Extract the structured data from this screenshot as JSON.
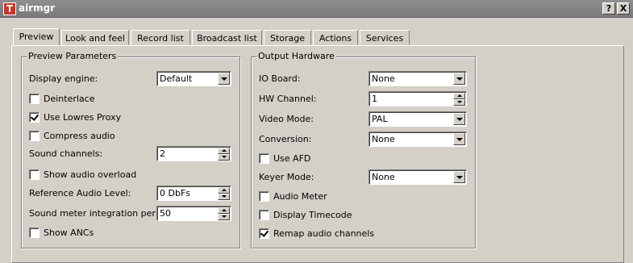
{
  "window": {
    "title": "airmgr",
    "help_label": "?",
    "close_label": "X"
  },
  "tabs": [
    {
      "label": "Preview",
      "active": true
    },
    {
      "label": "Look and feel"
    },
    {
      "label": "Record list"
    },
    {
      "label": "Broadcast list"
    },
    {
      "label": "Storage"
    },
    {
      "label": "Actions"
    },
    {
      "label": "Services"
    }
  ],
  "preview_parameters": {
    "title": "Preview Parameters",
    "display_engine": {
      "label": "Display engine:",
      "value": "Default"
    },
    "deinterlace": {
      "label": "Deinterlace",
      "checked": false
    },
    "use_lowres_proxy": {
      "label": "Use Lowres Proxy",
      "checked": true
    },
    "compress_audio": {
      "label": "Compress audio",
      "checked": false
    },
    "sound_channels": {
      "label": "Sound channels:",
      "value": "2"
    },
    "show_audio_overload": {
      "label": "Show audio overload",
      "checked": false
    },
    "reference_audio_level": {
      "label": "Reference Audio Level:",
      "value": "0 DbFs"
    },
    "sound_meter_integration_period": {
      "label": "Sound meter integration period:",
      "value": "50"
    },
    "show_ancs": {
      "label": "Show ANCs",
      "checked": false
    }
  },
  "output_hardware": {
    "title": "Output Hardware",
    "io_board": {
      "label": "IO Board:",
      "value": "None"
    },
    "hw_channel": {
      "label": "HW Channel:",
      "value": "1"
    },
    "video_mode": {
      "label": "Video Mode:",
      "value": "PAL"
    },
    "conversion": {
      "label": "Conversion:",
      "value": "None"
    },
    "use_afd": {
      "label": "Use AFD",
      "checked": false
    },
    "keyer_mode": {
      "label": "Keyer Mode:",
      "value": "None"
    },
    "audio_meter": {
      "label": "Audio Meter",
      "checked": false
    },
    "display_timecode": {
      "label": "Display Timecode",
      "checked": false
    },
    "remap_audio_channels": {
      "label": "Remap audio channels",
      "checked": true
    }
  }
}
